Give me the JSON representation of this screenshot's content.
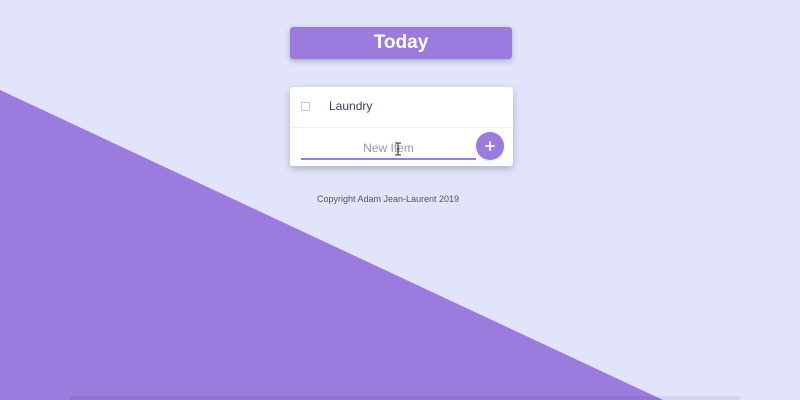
{
  "heading": {
    "title": "Today"
  },
  "list": {
    "items": [
      {
        "label": "Laundry",
        "checked": false
      }
    ]
  },
  "new_item": {
    "placeholder": "New Item",
    "value": ""
  },
  "add_button": {
    "icon": "plus-icon",
    "glyph": "+"
  },
  "footer": {
    "copyright": "Copyright Adam Jean-Laurent 2019"
  },
  "colors": {
    "background": "#E1E4FB",
    "accent": "#9B7BDE",
    "card": "#FFFFFF",
    "text": "#3F3F62"
  }
}
